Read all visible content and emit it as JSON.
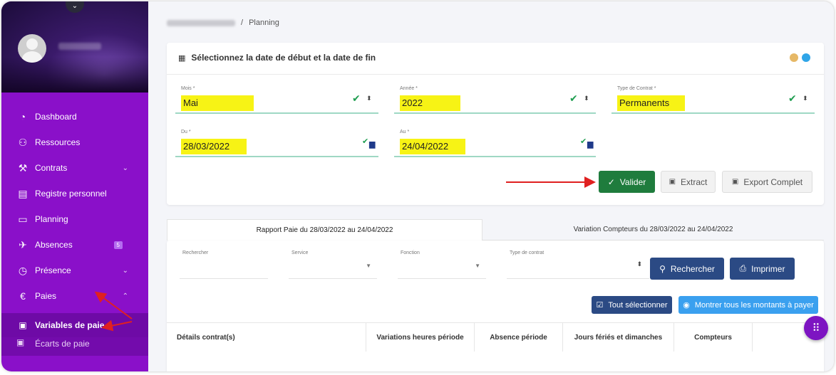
{
  "breadcrumb": {
    "current": "Planning",
    "sep": "/"
  },
  "sidebar": {
    "toggle_icon": "chevron-down-icon",
    "items": [
      {
        "label": "Dashboard",
        "icon": "dashboard-icon"
      },
      {
        "label": "Ressources",
        "icon": "users-icon"
      },
      {
        "label": "Contrats",
        "icon": "gavel-icon",
        "chevron": "⌄"
      },
      {
        "label": "Registre personnel",
        "icon": "book-icon"
      },
      {
        "label": "Planning",
        "icon": "calendar-icon"
      },
      {
        "label": "Absences",
        "icon": "plane-icon",
        "badge": "5"
      },
      {
        "label": "Présence",
        "icon": "clock-icon",
        "chevron": "⌄"
      },
      {
        "label": "Paies",
        "icon": "euro-icon",
        "chevron": "⌃"
      }
    ],
    "sub": {
      "label": "Variables de paie",
      "icon": "file-icon"
    },
    "sub2": {
      "label": "Écarts de paie"
    }
  },
  "form": {
    "title": "Sélectionnez la date de début et la date de fin",
    "mois_label": "Mois *",
    "mois_value": "Mai",
    "annee_label": "Année *",
    "annee_value": "2022",
    "contrat_label": "Type de Contrat *",
    "contrat_value": "Permanents",
    "du_label": "Du *",
    "du_value": "28/03/2022",
    "au_label": "Au *",
    "au_value": "24/04/2022",
    "valider": "Valider",
    "extract": "Extract",
    "export": "Export Complet",
    "accent_colors": [
      "#e6b866",
      "#2fa5e8"
    ]
  },
  "tabs": {
    "rapport": "Rapport Paie du 28/03/2022 au 24/04/2022",
    "variation": "Variation Compteurs du 28/03/2022 au 24/04/2022"
  },
  "filters": {
    "rechercher": "Rechercher",
    "service": "Service",
    "fonction": "Fonction",
    "type_contrat": "Type de contrat"
  },
  "actions": {
    "rechercher": "Rechercher",
    "imprimer": "Imprimer",
    "tout_selectionner": "Tout sélectionner",
    "montrer": "Montrer tous les montants à payer"
  },
  "table": {
    "headers": [
      "Détails contrat(s)",
      "Variations heures période",
      "Absence période",
      "Jours fériés et dimanches",
      "Compteurs"
    ]
  }
}
